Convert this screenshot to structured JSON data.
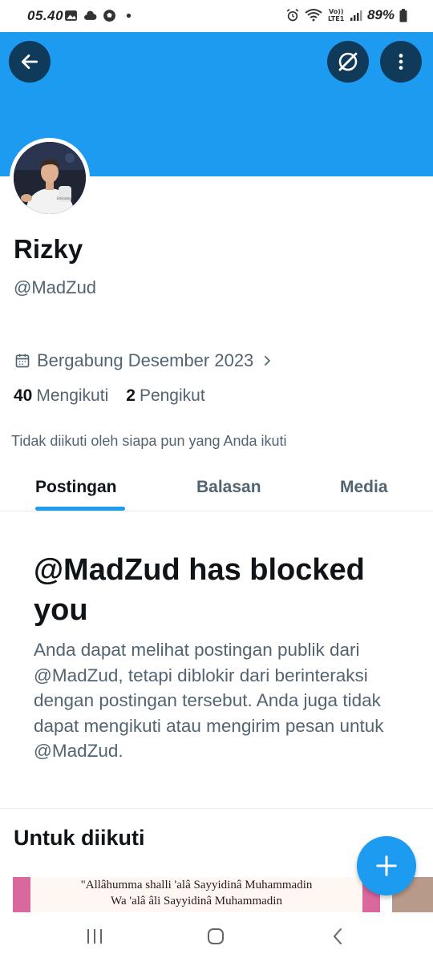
{
  "status_bar": {
    "time": "05.40",
    "battery": "89%",
    "left_icons": [
      "gallery-icon",
      "cloud-icon",
      "soccer-icon",
      "dot-icon"
    ],
    "right_icons": [
      "alarm-icon",
      "wifi-icon",
      "volte-icon",
      "signal-icon",
      "battery-icon"
    ]
  },
  "header": {
    "banner_color": "#1d9bf0",
    "buttons": [
      "back-arrow-icon",
      "grok-icon",
      "more-vertical-icon"
    ]
  },
  "profile": {
    "display_name": "Rizky",
    "handle": "@MadZud",
    "joined": "Bergabung Desember 2023",
    "following_count": "40",
    "following_label": "Mengikuti",
    "followers_count": "2",
    "followers_label": "Pengikut",
    "not_followed_note": "Tidak diikuti oleh siapa pun yang Anda ikuti"
  },
  "tabs": [
    {
      "label": "Postingan",
      "active": true
    },
    {
      "label": "Balasan",
      "active": false
    },
    {
      "label": "Media",
      "active": false
    }
  ],
  "blocked": {
    "title": "@MadZud has blocked you",
    "body": "Anda dapat melihat postingan publik dari @MadZud, tetapi diblokir dari berinteraksi dengan postingan tersebut. Anda juga tidak dapat mengikuti atau mengirim pesan untuk @MadZud."
  },
  "suggestions": {
    "title": "Untuk diikuti",
    "card_lines": [
      "\"Allâhumma shalli 'alâ Sayyidinâ Muhammadin",
      "Wa 'alâ âli Sayyidinâ Muhammadin"
    ]
  },
  "colors": {
    "accent": "#1d9bf0",
    "text_primary": "#0f1419",
    "text_secondary": "#536471"
  }
}
